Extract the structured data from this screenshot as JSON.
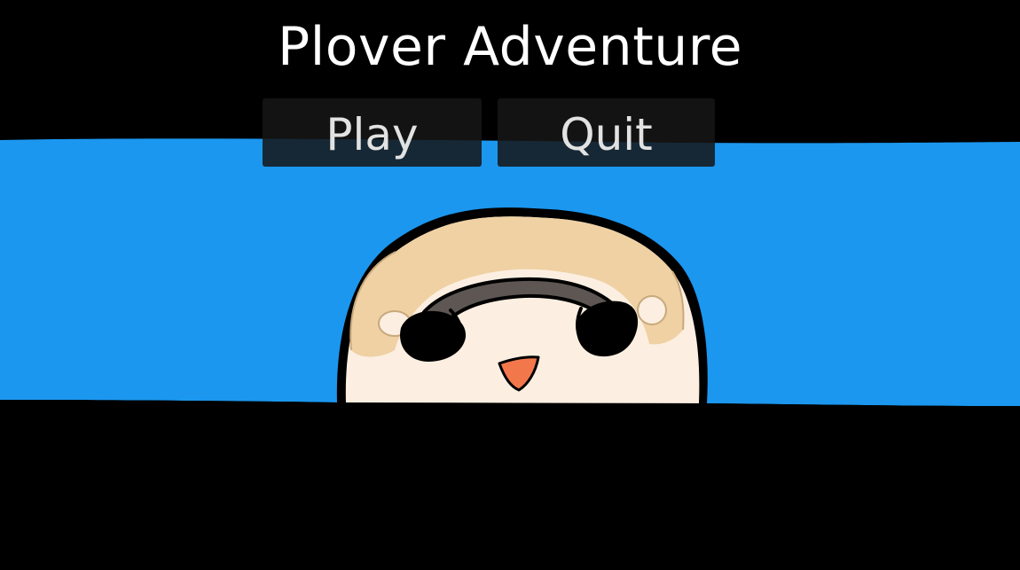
{
  "game": {
    "title": "Plover Adventure"
  },
  "menu": {
    "play_label": "Play",
    "quit_label": "Quit"
  },
  "scene": {
    "sky_band_color": "#1b97ef",
    "background_color": "#000000",
    "character": "plover-bird-peeking",
    "character_colors": {
      "outline": "#000000",
      "head_tan": "#efd1a4",
      "face_cream": "#fcefe1",
      "eye_mask": "#5e5652",
      "beak": "#f2784c"
    }
  }
}
